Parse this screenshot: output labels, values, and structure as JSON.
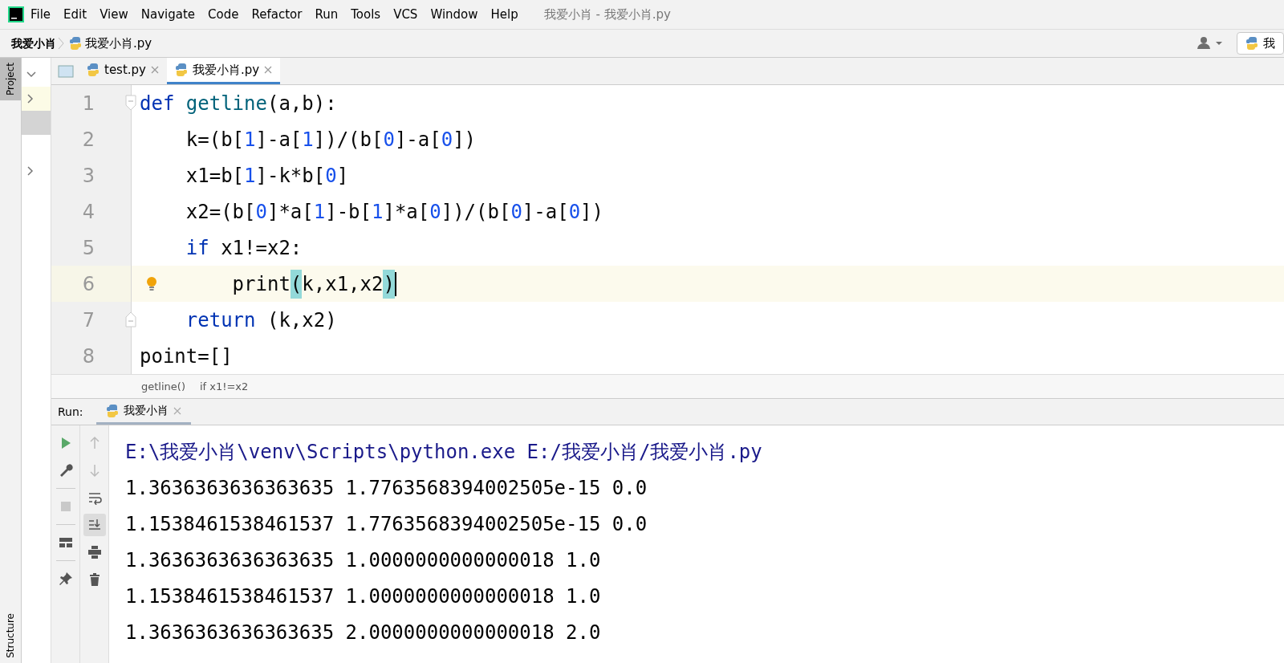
{
  "window": {
    "title": "我爱小肖 - 我爱小肖.py"
  },
  "menu": [
    "File",
    "Edit",
    "View",
    "Navigate",
    "Code",
    "Refactor",
    "Run",
    "Tools",
    "VCS",
    "Window",
    "Help"
  ],
  "breadcrumb": {
    "project": "我爱小肖",
    "file": "我爱小肖.py"
  },
  "run_config": {
    "label": "我"
  },
  "side_tabs": {
    "project": "Project",
    "structure": "Structure"
  },
  "editor_tabs": [
    {
      "label": "test.py",
      "selected": false
    },
    {
      "label": "我爱小肖.py",
      "selected": true
    }
  ],
  "code_lines": [
    {
      "number": "1",
      "current": false,
      "tokens": [
        {
          "text": "def ",
          "kind": "keyword"
        },
        {
          "text": "getline",
          "kind": "function"
        },
        {
          "text": "(a,b):",
          "kind": "plain"
        }
      ]
    },
    {
      "number": "2",
      "current": false,
      "tokens": [
        {
          "text": "    k=(b[",
          "kind": "plain"
        },
        {
          "text": "1",
          "kind": "number"
        },
        {
          "text": "]-a[",
          "kind": "plain"
        },
        {
          "text": "1",
          "kind": "number"
        },
        {
          "text": "])/(b[",
          "kind": "plain"
        },
        {
          "text": "0",
          "kind": "number"
        },
        {
          "text": "]-a[",
          "kind": "plain"
        },
        {
          "text": "0",
          "kind": "number"
        },
        {
          "text": "])",
          "kind": "plain"
        }
      ]
    },
    {
      "number": "3",
      "current": false,
      "tokens": [
        {
          "text": "    x1=b[",
          "kind": "plain"
        },
        {
          "text": "1",
          "kind": "number"
        },
        {
          "text": "]-k*b[",
          "kind": "plain"
        },
        {
          "text": "0",
          "kind": "number"
        },
        {
          "text": "]",
          "kind": "plain"
        }
      ]
    },
    {
      "number": "4",
      "current": false,
      "tokens": [
        {
          "text": "    x2=(b[",
          "kind": "plain"
        },
        {
          "text": "0",
          "kind": "number"
        },
        {
          "text": "]*a[",
          "kind": "plain"
        },
        {
          "text": "1",
          "kind": "number"
        },
        {
          "text": "]-b[",
          "kind": "plain"
        },
        {
          "text": "1",
          "kind": "number"
        },
        {
          "text": "]*a[",
          "kind": "plain"
        },
        {
          "text": "0",
          "kind": "number"
        },
        {
          "text": "])/(b[",
          "kind": "plain"
        },
        {
          "text": "0",
          "kind": "number"
        },
        {
          "text": "]-a[",
          "kind": "plain"
        },
        {
          "text": "0",
          "kind": "number"
        },
        {
          "text": "])",
          "kind": "plain"
        }
      ]
    },
    {
      "number": "5",
      "current": false,
      "tokens": [
        {
          "text": "    if ",
          "kind": "keyword"
        },
        {
          "text": "x1!=x2:",
          "kind": "plain"
        }
      ]
    },
    {
      "number": "6",
      "current": true,
      "tokens": [
        {
          "text": "        print",
          "kind": "plain"
        },
        {
          "text": "(",
          "kind": "brace-match"
        },
        {
          "text": "k,x1,x2",
          "kind": "plain"
        },
        {
          "text": ")",
          "kind": "brace-match"
        }
      ]
    },
    {
      "number": "7",
      "current": false,
      "tokens": [
        {
          "text": "    return ",
          "kind": "keyword"
        },
        {
          "text": "(k,x2)",
          "kind": "plain"
        }
      ]
    },
    {
      "number": "8",
      "current": false,
      "tokens": [
        {
          "text": "point=[]",
          "kind": "plain"
        }
      ]
    }
  ],
  "editor_breadcrumb": [
    "getline()",
    "if x1!=x2"
  ],
  "run_panel": {
    "label": "Run:",
    "tab": "我爱小肖",
    "output": [
      {
        "text": "E:\\我爱小肖\\venv\\Scripts\\python.exe E:/我爱小肖/我爱小肖.py",
        "kind": "command"
      },
      {
        "text": "1.3636363636363635 1.7763568394002505e-15 0.0",
        "kind": "stdout"
      },
      {
        "text": "1.1538461538461537 1.7763568394002505e-15 0.0",
        "kind": "stdout"
      },
      {
        "text": "1.3636363636363635 1.0000000000000018 1.0",
        "kind": "stdout"
      },
      {
        "text": "1.1538461538461537 1.0000000000000018 1.0",
        "kind": "stdout"
      },
      {
        "text": "1.3636363636363635 2.0000000000000018 2.0",
        "kind": "stdout"
      }
    ]
  }
}
